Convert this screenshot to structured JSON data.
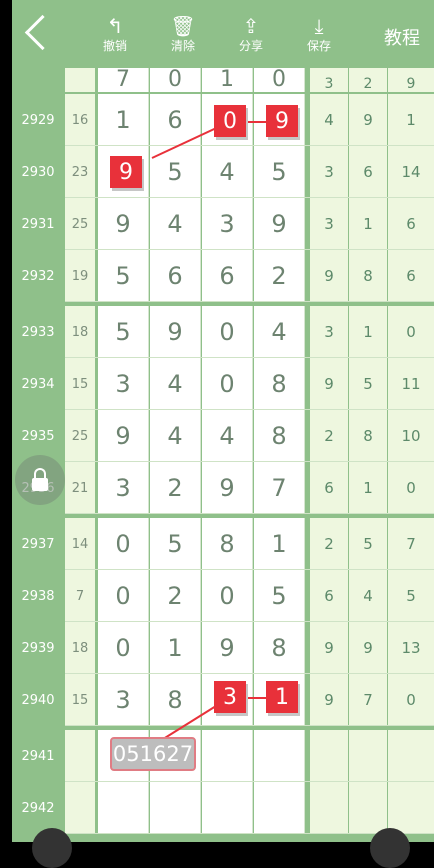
{
  "toolbar": {
    "undo_label": "撤销",
    "clear_label": "清除",
    "share_label": "分享",
    "save_label": "保存",
    "help_label": "教程"
  },
  "partial_row": {
    "digits": [
      "7",
      "0",
      "1",
      "0"
    ],
    "stats": [
      "3",
      "2",
      "9"
    ]
  },
  "rows": [
    {
      "id": "2929",
      "sum": "16",
      "digits": [
        "1",
        "6",
        "0",
        "9"
      ],
      "stats": [
        "4",
        "9",
        "1"
      ]
    },
    {
      "id": "2930",
      "sum": "23",
      "digits": [
        "9",
        "5",
        "4",
        "5"
      ],
      "stats": [
        "3",
        "6",
        "14"
      ]
    },
    {
      "id": "2931",
      "sum": "25",
      "digits": [
        "9",
        "4",
        "3",
        "9"
      ],
      "stats": [
        "3",
        "1",
        "6"
      ]
    },
    {
      "id": "2932",
      "sum": "19",
      "digits": [
        "5",
        "6",
        "6",
        "2"
      ],
      "stats": [
        "9",
        "8",
        "6"
      ]
    },
    {
      "id": "2933",
      "sum": "18",
      "digits": [
        "5",
        "9",
        "0",
        "4"
      ],
      "stats": [
        "3",
        "1",
        "0"
      ]
    },
    {
      "id": "2934",
      "sum": "15",
      "digits": [
        "3",
        "4",
        "0",
        "8"
      ],
      "stats": [
        "9",
        "5",
        "11"
      ]
    },
    {
      "id": "2935",
      "sum": "25",
      "digits": [
        "9",
        "4",
        "4",
        "8"
      ],
      "stats": [
        "2",
        "8",
        "10"
      ]
    },
    {
      "id": "2936",
      "sum": "21",
      "digits": [
        "3",
        "2",
        "9",
        "7"
      ],
      "stats": [
        "6",
        "1",
        "0"
      ]
    },
    {
      "id": "2937",
      "sum": "14",
      "digits": [
        "0",
        "5",
        "8",
        "1"
      ],
      "stats": [
        "2",
        "5",
        "7"
      ]
    },
    {
      "id": "2938",
      "sum": "7",
      "digits": [
        "0",
        "2",
        "0",
        "5"
      ],
      "stats": [
        "6",
        "4",
        "5"
      ]
    },
    {
      "id": "2939",
      "sum": "18",
      "digits": [
        "0",
        "1",
        "9",
        "8"
      ],
      "stats": [
        "9",
        "9",
        "13"
      ]
    },
    {
      "id": "2940",
      "sum": "15",
      "digits": [
        "3",
        "8",
        "3",
        "1"
      ],
      "stats": [
        "9",
        "7",
        "0"
      ]
    },
    {
      "id": "2941",
      "sum": "",
      "digits": [
        "",
        "",
        "",
        ""
      ],
      "stats": [
        "",
        "",
        ""
      ]
    },
    {
      "id": "2942",
      "sum": "",
      "digits": [
        "",
        "",
        "",
        ""
      ],
      "stats": [
        "",
        "",
        ""
      ]
    }
  ],
  "marks": {
    "m1": "0",
    "m2": "9",
    "m3": "9",
    "m4": "3",
    "m5": "1"
  },
  "input_value": "051627",
  "colors": {
    "header": "#8fc08a",
    "mark": "#e8313a",
    "grid_light": "#eef7df"
  }
}
